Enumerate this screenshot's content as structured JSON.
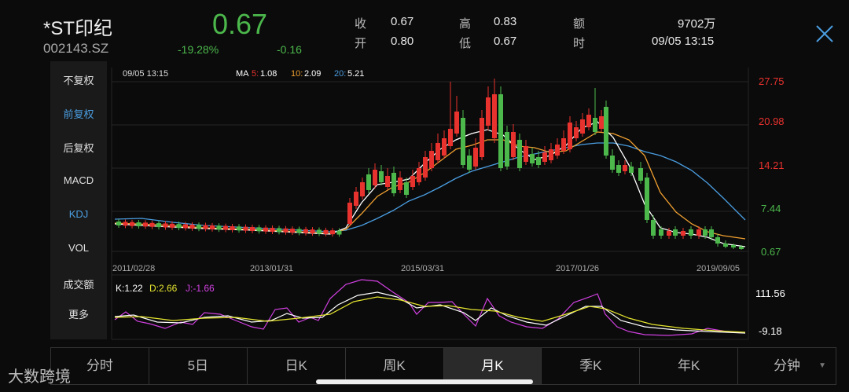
{
  "stock": {
    "name": "*ST印纪",
    "code": "002143.SZ",
    "price": "0.67",
    "change_pct": "-19.28%",
    "change": "-0.16",
    "close_label": "收",
    "close_value": "0.67",
    "high_label": "高",
    "high_value": "0.83",
    "amount_label": "额",
    "amount_value": "9702万",
    "open_label": "开",
    "open_value": "0.80",
    "low_label": "低",
    "low_value": "0.67",
    "time_label": "时",
    "time_value": "09/05 13:15"
  },
  "colors": {
    "up": "#e8322e",
    "down": "#4cb84c",
    "ma5": "#ffffff",
    "ma10": "#f0a030",
    "ma20": "#4a9de0",
    "k": "#ffffff",
    "d": "#e6e630",
    "j": "#d040e0"
  },
  "sidebar": {
    "items": [
      "不复权",
      "前复权",
      "后复权",
      "MACD",
      "KDJ",
      "VOL",
      "成交额",
      "更多"
    ],
    "active": [
      "前复权",
      "KDJ"
    ]
  },
  "tabs": {
    "items": [
      "分时",
      "5日",
      "日K",
      "周K",
      "月K",
      "季K",
      "年K",
      "分钟"
    ],
    "active": "月K"
  },
  "chart": {
    "timestamp": "09/05 13:15",
    "ma_label": "MA",
    "ma5_label": "5:",
    "ma5_value": "1.08",
    "ma10_label": "10:",
    "ma10_value": "2.09",
    "ma20_label": "20:",
    "ma20_value": "5.21",
    "kdj_k": "K:1.22",
    "kdj_d": "D:2.66",
    "kdj_j": "J:-1.66",
    "kdj_top": "111.56",
    "kdj_bottom": "-9.18"
  },
  "chart_data": {
    "type": "candlestick",
    "price_axis": [
      "27.75",
      "20.98",
      "14.21",
      "7.44",
      "0.67"
    ],
    "date_labels": [
      "2011/02/28",
      "2013/01/31",
      "2015/03/31",
      "2017/01/26",
      "2019/09/05"
    ],
    "ylim": [
      0.67,
      27.75
    ]
  },
  "watermark": "大数跨境"
}
